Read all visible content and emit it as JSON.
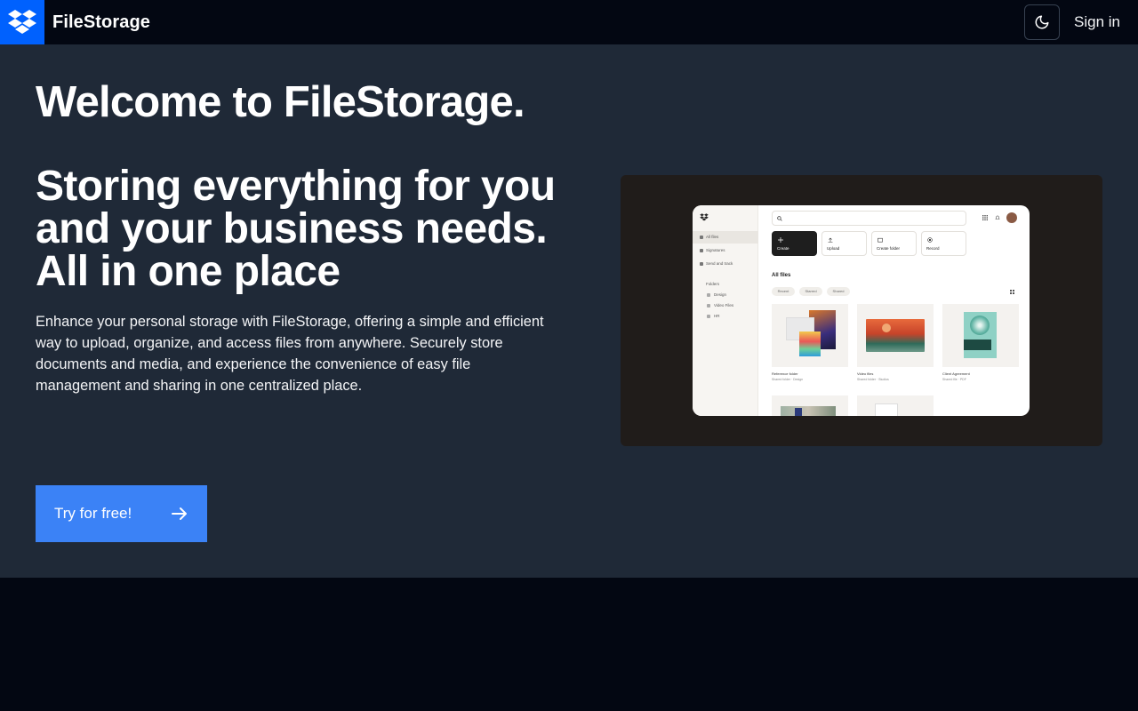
{
  "navbar": {
    "brand_name": "FileStorage",
    "signin_label": "Sign in",
    "logo_icon": "dropbox-logo-icon",
    "theme_icon": "moon-icon"
  },
  "hero": {
    "welcome": "Welcome to FileStorage.",
    "tagline": "Storing everything for you and your business needs. All in one place",
    "description": "Enhance your personal storage with FileStorage, offering a simple and efficient way to upload, organize, and access files from anywhere. Securely store documents and media, and experience the convenience of easy file management and sharing in one centralized place.",
    "cta_label": "Try for free!",
    "cta_icon": "arrow-right-icon"
  },
  "preview": {
    "sidebar": [
      "All files",
      "Signatures",
      "Send and track"
    ],
    "folders_label": "Folders",
    "folders": [
      "Design",
      "Video Files",
      "HR"
    ],
    "actions": [
      "Create",
      "Upload",
      "Create folder",
      "Record"
    ],
    "heading": "All files",
    "chips": [
      "Recent",
      "Starred",
      "Shared"
    ],
    "cards": [
      {
        "title": "Reference folder",
        "sub": "Shared folder · Design"
      },
      {
        "title": "Video files",
        "sub": "Shared folder · Studios"
      },
      {
        "title": "Client Agreement",
        "sub": "Shared file · PDF"
      }
    ]
  },
  "colors": {
    "accent": "#3b82f6",
    "logo_bg": "#0061fe",
    "hero_bg": "#1f2937",
    "nav_bg": "#030712"
  }
}
